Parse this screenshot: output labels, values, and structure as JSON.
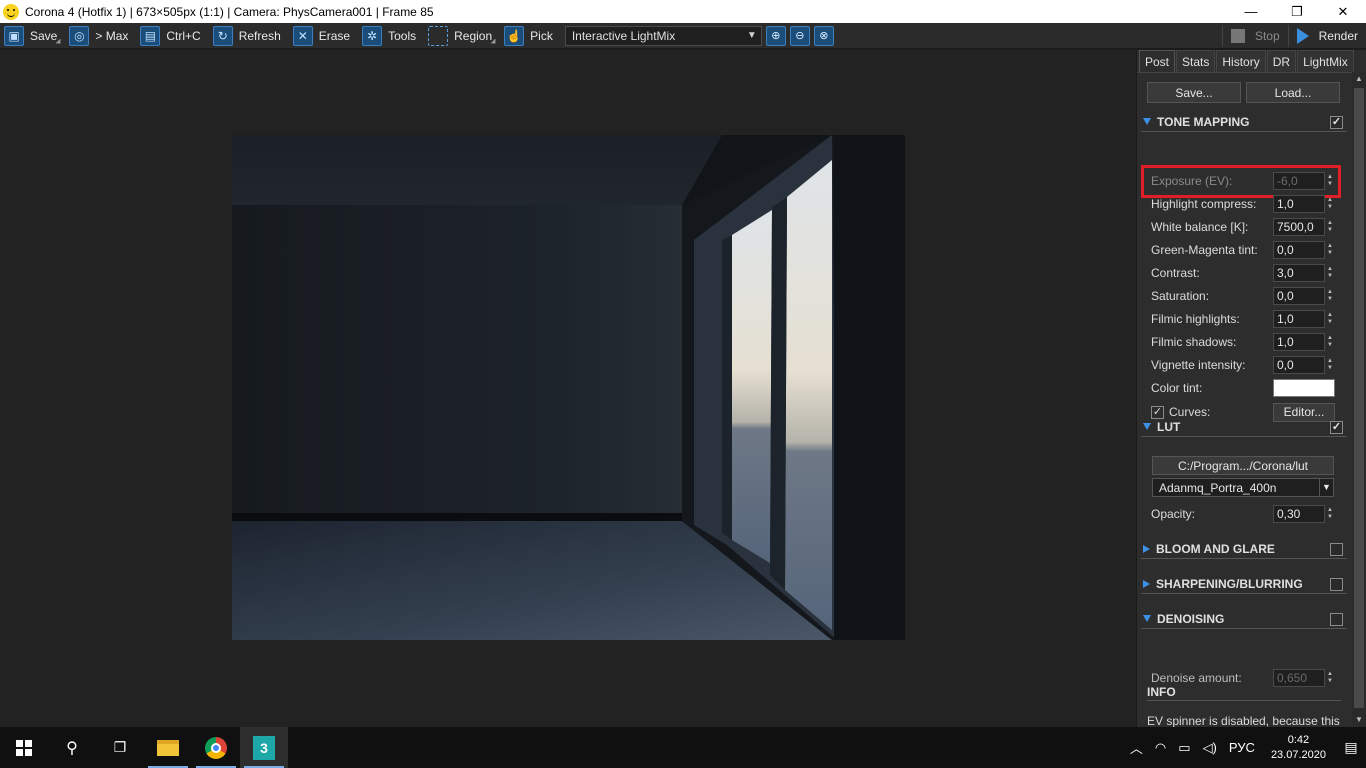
{
  "window": {
    "title": "Corona 4 (Hotfix 1) | 673×505px (1:1) | Camera: PhysCamera001 | Frame 85",
    "min_symbol": "—",
    "max_symbol": "❐",
    "close_symbol": "✕"
  },
  "toolbar": {
    "save": "Save",
    "to_max": "> Max",
    "copy": "Ctrl+C",
    "refresh": "Refresh",
    "erase": "Erase",
    "tools": "Tools",
    "region": "Region",
    "pick": "Pick",
    "mode_select": "Interactive LightMix",
    "stop": "Stop",
    "render": "Render"
  },
  "panel": {
    "tabs": [
      "Post",
      "Stats",
      "History",
      "DR",
      "LightMix"
    ],
    "save_btn": "Save...",
    "load_btn": "Load...",
    "tone_mapping": {
      "header": "TONE MAPPING",
      "enabled": true,
      "params": [
        {
          "label": "Exposure (EV):",
          "value": "-6,0",
          "disabled": true
        },
        {
          "label": "Highlight compress:",
          "value": "1,0"
        },
        {
          "label": "White balance [K]:",
          "value": "7500,0"
        },
        {
          "label": "Green-Magenta tint:",
          "value": "0,0"
        },
        {
          "label": "Contrast:",
          "value": "3,0"
        },
        {
          "label": "Saturation:",
          "value": "0,0"
        },
        {
          "label": "Filmic highlights:",
          "value": "1,0"
        },
        {
          "label": "Filmic shadows:",
          "value": "1,0"
        },
        {
          "label": "Vignette intensity:",
          "value": "0,0"
        }
      ],
      "color_tint_label": "Color tint:",
      "color_tint": "#ffffff",
      "curves_label": "Curves:",
      "curves_checked": true,
      "editor_btn": "Editor..."
    },
    "lut": {
      "header": "LUT",
      "enabled": true,
      "path": "C:/Program.../Corona/lut",
      "selected": "Adanmq_Portra_400n",
      "opacity_label": "Opacity:",
      "opacity": "0,30"
    },
    "bloom": {
      "header": "BLOOM AND GLARE",
      "enabled": false
    },
    "sharpening": {
      "header": "SHARPENING/BLURRING",
      "enabled": false
    },
    "denoising": {
      "header": "DENOISING",
      "enabled": false,
      "amount_label": "Denoise amount:",
      "amount": "0,650"
    },
    "info": {
      "header": "INFO",
      "text": "EV spinner is disabled, because this"
    }
  },
  "taskbar": {
    "lang": "РУС",
    "time": "0:42",
    "date": "23.07.2020"
  },
  "colors": {
    "accent": "#3c93e6",
    "highlight": "#e01e25"
  }
}
